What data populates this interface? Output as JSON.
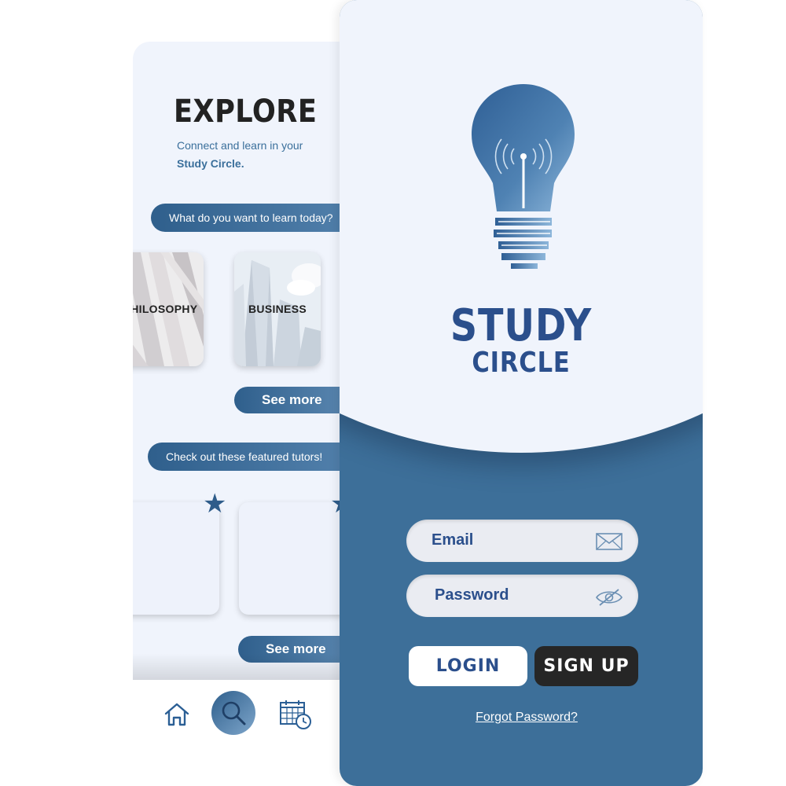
{
  "explore": {
    "title": "EXPLORE",
    "subtitle_line1": "Connect and learn in your",
    "subtitle_line2": "Study Circle.",
    "learn_prompt": "What do you want to learn today?",
    "categories": [
      {
        "label": "PHILOSOPHY"
      },
      {
        "label": "BUSINESS"
      }
    ],
    "see_more_label": "See more",
    "featured_prompt": "Check out these featured tutors!",
    "nav": [
      "home-icon",
      "search-icon",
      "calendar-clock-icon"
    ]
  },
  "login": {
    "brand_line1": "STUDY",
    "brand_line2": "CIRCLE",
    "email_placeholder": "Email",
    "password_placeholder": "Password",
    "login_label": "LOGIN",
    "signup_label": "SIGN UP",
    "forgot_label": "Forgot Password?"
  },
  "colors": {
    "primary_blue": "#3d6f99",
    "brand_text": "#2b4f8c",
    "background_light": "#f0f4fc",
    "dark_button": "#262626"
  }
}
